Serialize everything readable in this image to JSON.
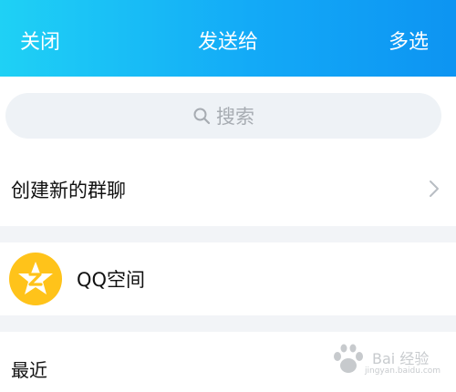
{
  "header": {
    "left_label": "关闭",
    "title": "发送给",
    "right_label": "多选"
  },
  "search": {
    "placeholder": "搜索"
  },
  "items": {
    "create_group": "创建新的群聊",
    "qzone": "QQ空间"
  },
  "sections": {
    "recent": "最近"
  },
  "watermark": {
    "text": "Bai 经验",
    "sub": "jingyan.baidu.com"
  },
  "colors": {
    "header_gradient_start": "#1fd1f5",
    "header_gradient_end": "#0d94f2",
    "qzone_yellow": "#ffc31a"
  }
}
